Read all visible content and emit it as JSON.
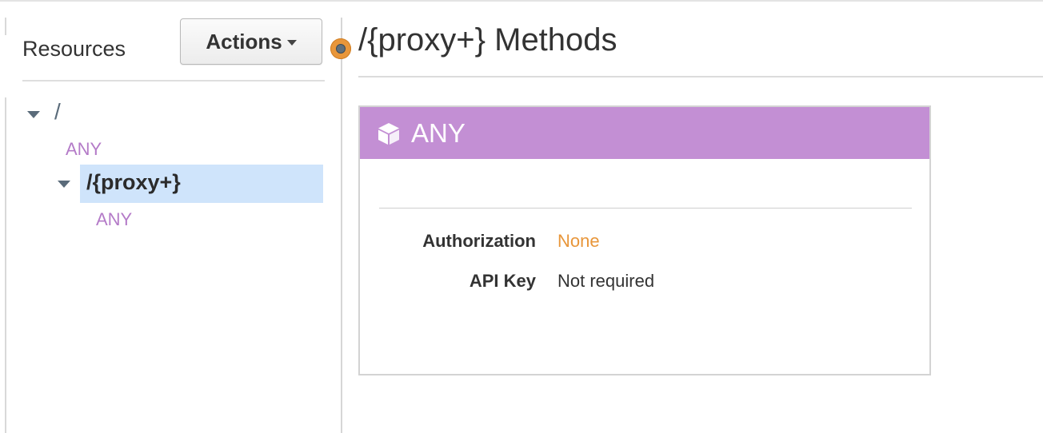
{
  "resources_panel": {
    "title": "Resources",
    "actions_label": "Actions",
    "tree": {
      "root_path": "/",
      "root_method": "ANY",
      "child_path": "/{proxy+}",
      "child_method": "ANY"
    }
  },
  "main": {
    "title": "/{proxy+} Methods",
    "method_card": {
      "method": "ANY",
      "header_color": "#c38fd4",
      "rows": [
        {
          "label": "Authorization",
          "value": "None",
          "value_color": "#e8963a"
        },
        {
          "label": "API Key",
          "value": "Not required",
          "value_color": "#333333"
        }
      ]
    }
  },
  "colors": {
    "method_link": "#b47bc8",
    "selected_row": "#cfe4fb",
    "splitter_handle": "#e8963a"
  }
}
